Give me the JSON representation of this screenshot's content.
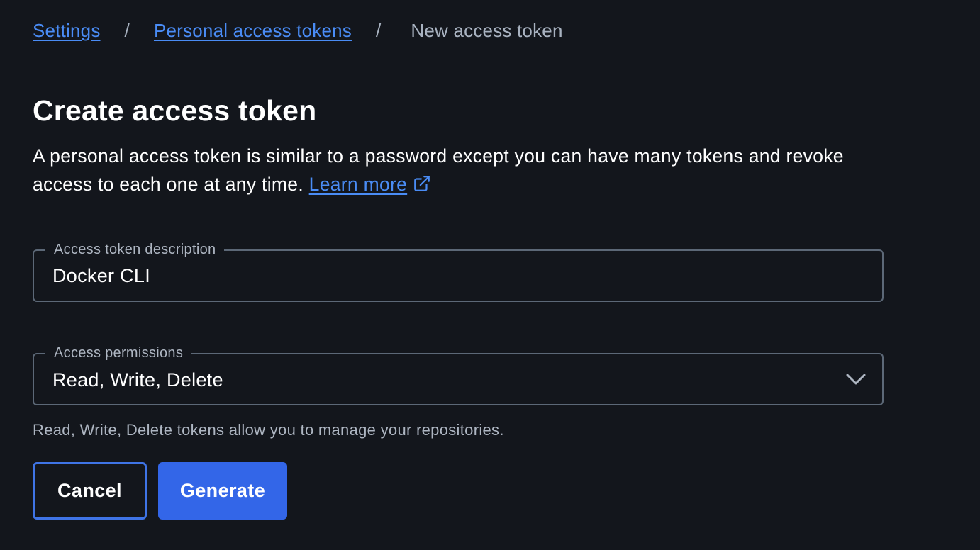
{
  "breadcrumb": {
    "settings": "Settings",
    "separator": "/",
    "tokens": "Personal access tokens",
    "current": "New access token"
  },
  "page": {
    "title": "Create access token",
    "intro_text": "A personal access token is similar to a password except you can have many tokens and revoke access to each one at any time.",
    "learn_more": "Learn more",
    "learn_more_icon": "external-link-icon"
  },
  "form": {
    "description": {
      "label": "Access token description",
      "value": "Docker CLI"
    },
    "permissions": {
      "label": "Access permissions",
      "selected": "Read, Write, Delete",
      "icon": "chevron-down-icon"
    },
    "helper_text": "Read, Write, Delete tokens allow you to manage your repositories."
  },
  "actions": {
    "cancel": "Cancel",
    "generate": "Generate"
  },
  "colors": {
    "background": "#13161c",
    "link": "#4a8cf5",
    "primary": "#3366e8",
    "border": "#5c6877"
  }
}
